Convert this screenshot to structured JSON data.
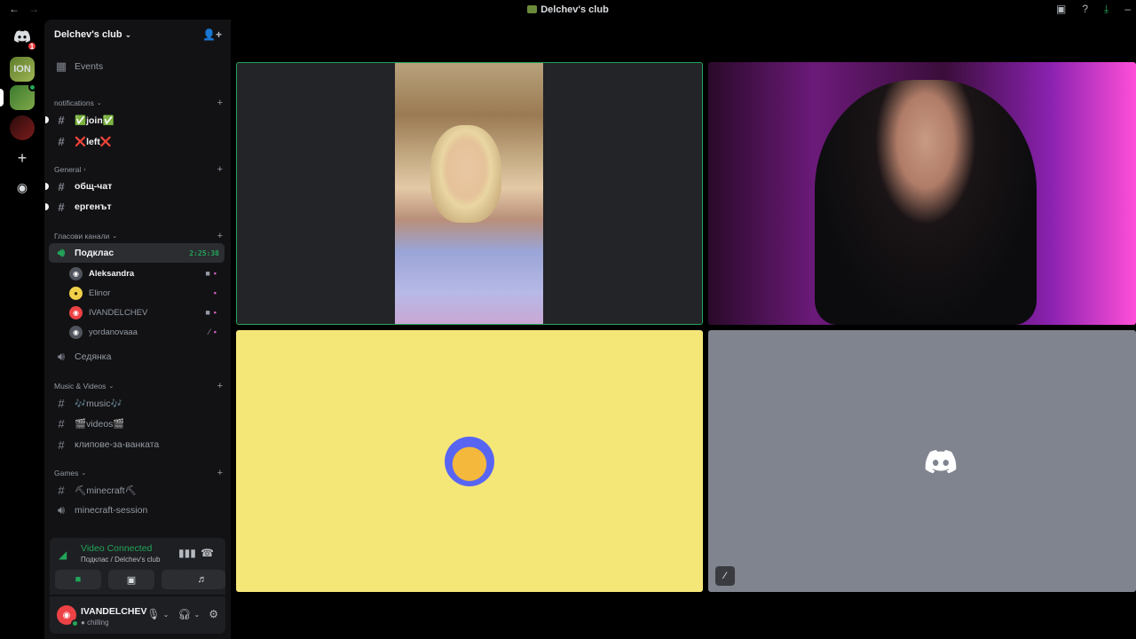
{
  "titlebar": {
    "back": "←",
    "forward": "→",
    "title": "Delchev's club",
    "inbox_icon": "inbox-icon",
    "help_icon": "help-icon",
    "download_icon": "download-icon",
    "minimize": "–"
  },
  "rail": {
    "home_badge": "1",
    "server1_initials": "ION",
    "add": "+",
    "discover": "◉"
  },
  "server": {
    "name": "Delchev's club",
    "chevron": "⌄",
    "invite_icon": "👤+"
  },
  "channels": {
    "events": "Events",
    "categories": {
      "notifications": "notifications",
      "general": "General",
      "voice": "Гласови канали",
      "music": "Music & Videos",
      "games": "Games"
    },
    "join": "✅join✅",
    "left": "❌left❌",
    "general_chat": "общ-чат",
    "ergenat": "ергенът",
    "podklas": "Подклас",
    "podklas_timer": "2:25:38",
    "sedyanka": "Седянка",
    "music": "🎶music🎶",
    "videos": "🎬videos🎬",
    "klipove": "клипове-за-ванката",
    "minecraft": "⛏minecraft⛏",
    "minecraft_session": "minecraft-session"
  },
  "voice_users": [
    {
      "name": "Aleksandra"
    },
    {
      "name": "Elinor"
    },
    {
      "name": "IVANDELCHEV"
    },
    {
      "name": "yordanovaaa"
    }
  ],
  "voice_panel": {
    "status": "Video Connected",
    "channel": "Подклас / Delchev's club"
  },
  "user_panel": {
    "name": "IVANDELCHEV",
    "status": "chilling"
  },
  "colors": {
    "connected_green": "#23a55a",
    "sidebar_bg": "#121214",
    "yellow_tile": "#f5e678",
    "gray_tile": "#80848e"
  }
}
